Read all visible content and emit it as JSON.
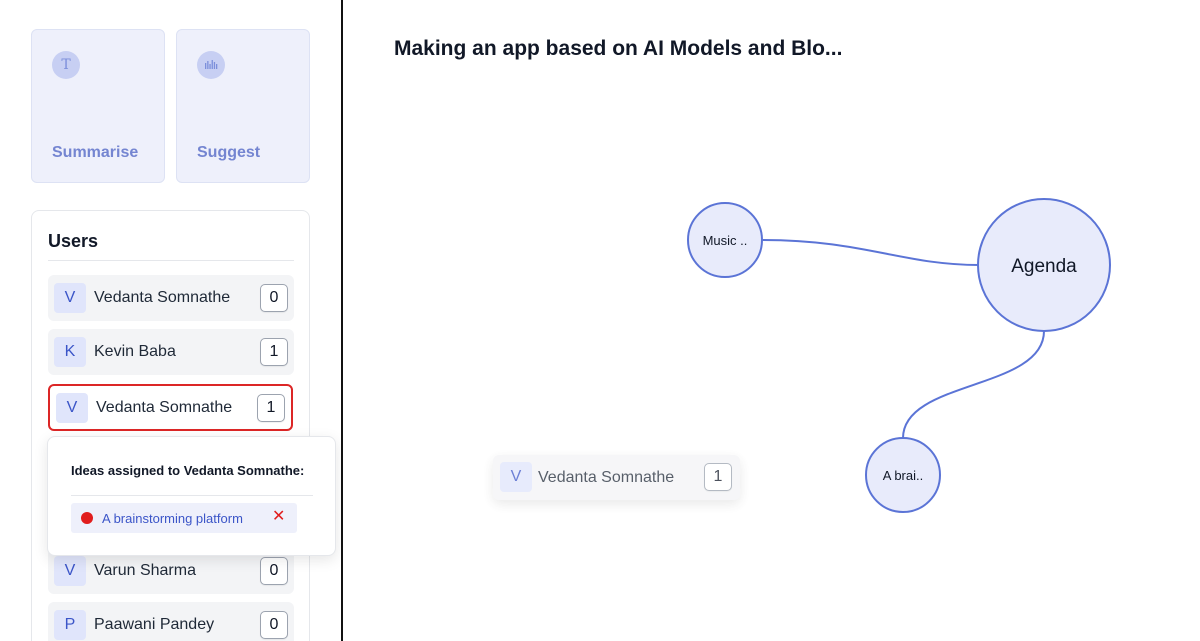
{
  "tools": {
    "summarise": {
      "label": "Summarise",
      "icon": "text-icon",
      "glyph": "T"
    },
    "suggest": {
      "label": "Suggest",
      "icon": "audio-wave-icon"
    }
  },
  "users": {
    "title": "Users",
    "items": [
      {
        "initial": "V",
        "name": "Vedanta Somnathe",
        "count": "0",
        "selected": false
      },
      {
        "initial": "K",
        "name": "Kevin Baba",
        "count": "1",
        "selected": false
      },
      {
        "initial": "V",
        "name": "Vedanta Somnathe",
        "count": "1",
        "selected": true
      },
      {
        "initial": "V",
        "name": "Varun Sharma",
        "count": "0",
        "selected": false
      },
      {
        "initial": "P",
        "name": "Paawani Pandey",
        "count": "0",
        "selected": false
      }
    ]
  },
  "popover": {
    "title": "Ideas assigned to Vedanta Somnathe:",
    "ideas": [
      {
        "label": "A brainstorming platform",
        "status_color": "#e11d1d",
        "remove_glyph": "✕"
      }
    ]
  },
  "main": {
    "title": "Making an app based on AI Models and Blo..."
  },
  "graph": {
    "nodes": {
      "music": "Music ..",
      "agenda": "Agenda",
      "brain": "A brai.."
    },
    "edge_color": "#5b74d6",
    "node_fill": "#e8ebfb"
  },
  "drag_chip": {
    "initial": "V",
    "name": "Vedanta Somnathe",
    "count": "1"
  },
  "colors": {
    "accent": "#3b55c8",
    "selected_border": "#dc2626",
    "status_red": "#e11d1d",
    "card_bg": "#eef0fb"
  }
}
